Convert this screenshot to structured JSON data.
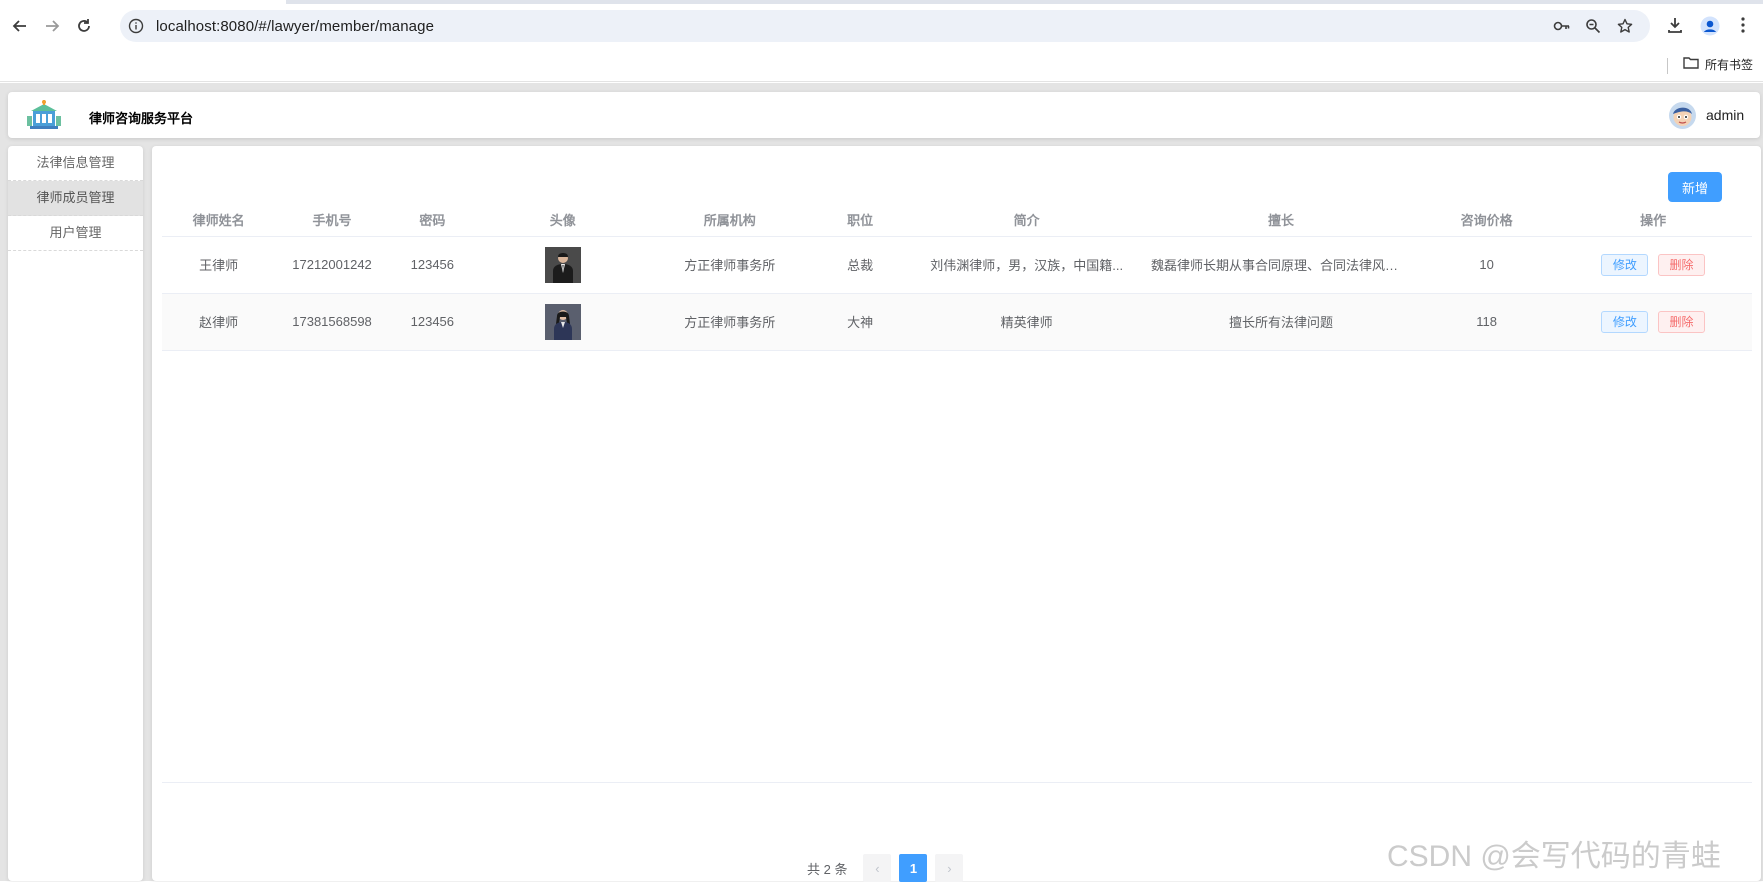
{
  "browser": {
    "url": "localhost:8080/#/lawyer/member/manage",
    "bookmarks_folder": "所有书签",
    "icons": [
      "back-icon",
      "forward-icon",
      "reload-icon",
      "info-icon",
      "key-icon",
      "zoom-icon",
      "star-icon",
      "download-icon",
      "profile-icon",
      "menu-icon",
      "folder-icon"
    ]
  },
  "header": {
    "brand": "律师咨询服务平台",
    "username": "admin"
  },
  "sidebar": {
    "items": [
      {
        "label": "法律信息管理",
        "active": false
      },
      {
        "label": "律师成员管理",
        "active": true
      },
      {
        "label": "用户管理",
        "active": false
      }
    ]
  },
  "toolbar": {
    "add_label": "新增"
  },
  "table": {
    "columns": [
      "律师姓名",
      "手机号",
      "密码",
      "头像",
      "所属机构",
      "职位",
      "简介",
      "擅长",
      "咨询价格",
      "操作"
    ],
    "rows": [
      {
        "name": "王律师",
        "phone": "17212001242",
        "password": "123456",
        "org": "方正律师事务所",
        "position": "总裁",
        "intro": "刘伟渊律师，男，汉族，中国籍...",
        "specialty": "魏磊律师长期从事合同原理、合同法律风险的...",
        "price": "10",
        "edit": "修改",
        "delete": "删除"
      },
      {
        "name": "赵律师",
        "phone": "17381568598",
        "password": "123456",
        "org": "方正律师事务所",
        "position": "大神",
        "intro": "精英律师",
        "specialty": "擅长所有法律问题",
        "price": "118",
        "edit": "修改",
        "delete": "删除"
      }
    ]
  },
  "pagination": {
    "total_text": "共 2 条",
    "current_page": "1",
    "prev": "‹",
    "next": "›"
  },
  "watermark": "CSDN @会写代码的青蛙",
  "colors": {
    "primary": "#409eff",
    "danger": "#f56c6c",
    "background": "#e4e4e4"
  }
}
